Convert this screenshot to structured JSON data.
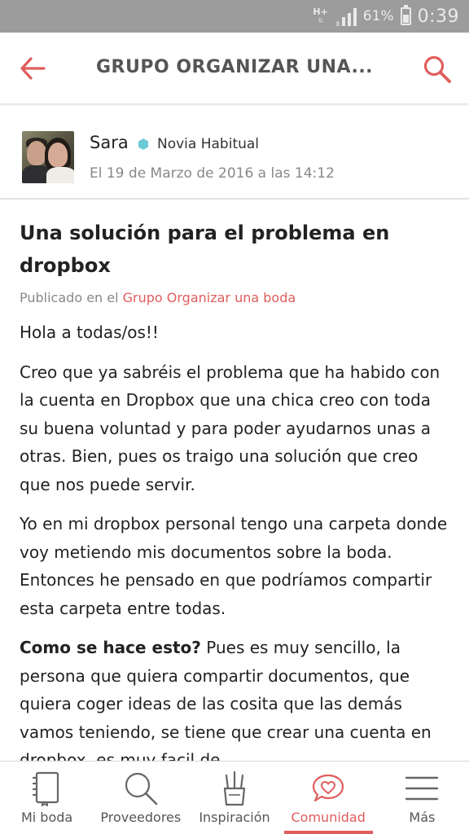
{
  "status_bar": {
    "network_type": "H+",
    "network_sub": "⇅",
    "battery_percent": "61%",
    "time": "0:39"
  },
  "header": {
    "title": "GRUPO ORGANIZAR UNA...",
    "back_icon": "arrow-left-icon",
    "search_icon": "search-icon",
    "accent_color": "#e05d5d"
  },
  "author": {
    "name": "Sara",
    "role": "Novia Habitual",
    "date": "El 19 de Marzo de 2016 a las 14:12",
    "badge_color": "#6ccad6"
  },
  "post": {
    "title": "Una solución para el problema en dropbox",
    "published_prefix": "Publicado en el",
    "group_name": "Grupo Organizar una boda",
    "greeting": "Hola a todas/os!!",
    "paragraph_1": "Creo que ya sabréis el problema que ha habido con la cuenta en Dropbox que una chica creo con toda su buena voluntad y para poder ayudarnos unas a otras. Bien, pues os traigo una solución que creo que nos puede servir.",
    "paragraph_2": "Yo en mi dropbox personal tengo una carpeta donde voy metiendo mis documentos sobre la boda. Entonces he pensado en que podríamos compartir esta carpeta entre todas.",
    "paragraph_3_bold": "Como se hace esto?",
    "paragraph_3_text": " Pues es muy sencillo, la persona que quiera compartir documentos, que quiera coger ideas de las cosita que las demás vamos teniendo, se tiene que crear una cuenta en dropbox, es muy facil de"
  },
  "bottom_nav": {
    "items": [
      {
        "label": "Mi boda",
        "icon": "notebook-icon"
      },
      {
        "label": "Proveedores",
        "icon": "search-icon"
      },
      {
        "label": "Inspiración",
        "icon": "pencil-cup-icon"
      },
      {
        "label": "Comunidad",
        "icon": "heart-bubble-icon",
        "active": true
      },
      {
        "label": "Más",
        "icon": "menu-icon"
      }
    ]
  }
}
